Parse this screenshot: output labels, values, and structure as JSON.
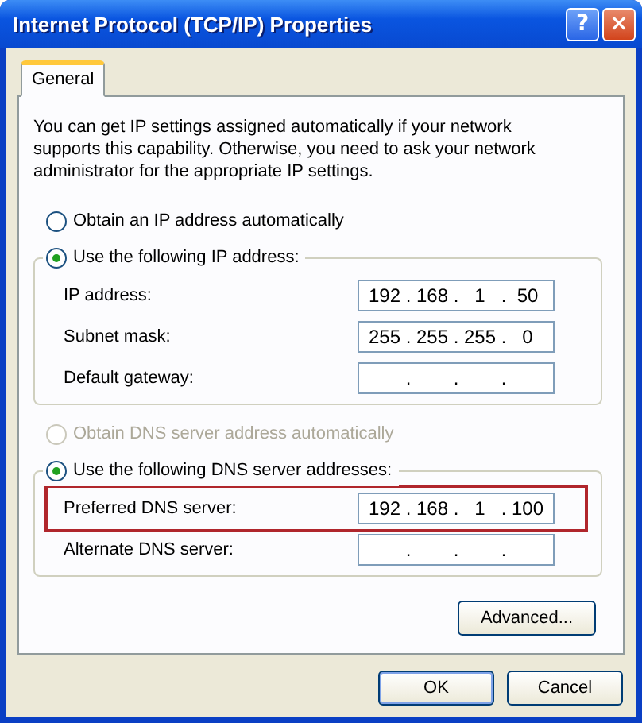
{
  "window": {
    "title": "Internet Protocol (TCP/IP) Properties",
    "help_button": "?",
    "close_button": "×"
  },
  "tabs": [
    {
      "label": "General",
      "selected": true
    }
  ],
  "intro": "You can get IP settings assigned automatically if your network supports this capability. Otherwise, you need to ask your network administrator for the appropriate IP settings.",
  "sections": [
    {
      "auto_option": {
        "label": "Obtain an IP address automatically",
        "selected": false,
        "disabled": false
      },
      "manual_option": {
        "label": "Use the following IP address:",
        "selected": true,
        "disabled": false
      },
      "fields": [
        {
          "label": "IP address:",
          "octets": [
            "192",
            "168",
            "1",
            "50"
          ],
          "dots": [
            ".",
            ".",
            "."
          ],
          "highlighted": false
        },
        {
          "label": "Subnet mask:",
          "octets": [
            "255",
            "255",
            "255",
            "0"
          ],
          "dots": [
            ".",
            ".",
            "."
          ],
          "highlighted": false
        },
        {
          "label": "Default gateway:",
          "dots": [
            ".",
            ".",
            "."
          ],
          "highlighted": false
        }
      ]
    },
    {
      "auto_option": {
        "label": "Obtain DNS server address automatically",
        "selected": false,
        "disabled": true
      },
      "manual_option": {
        "label": "Use the following DNS server addresses:",
        "selected": true,
        "disabled": false
      },
      "fields": [
        {
          "label": "Preferred DNS server:",
          "octets": [
            "192",
            "168",
            "1",
            "100"
          ],
          "dots": [
            ".",
            ".",
            "."
          ],
          "highlighted": true
        },
        {
          "label": "Alternate DNS server:",
          "dots": [
            ".",
            ".",
            "."
          ],
          "highlighted": false
        }
      ]
    }
  ],
  "advanced_button": "Advanced...",
  "buttons": [
    {
      "label": "OK",
      "default": true
    },
    {
      "label": "Cancel",
      "default": false
    }
  ]
}
